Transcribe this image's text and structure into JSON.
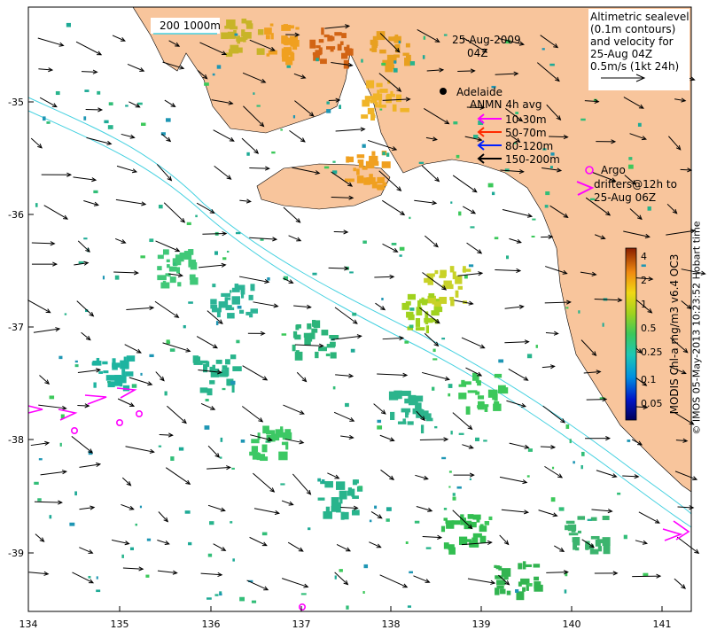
{
  "map": {
    "date": "25-Aug-2009",
    "time": "04Z",
    "city": "Adelaide",
    "scale_bar": "200  1000m",
    "legend_title": [
      "Altimetric sealevel",
      "(0.1m contours)",
      "and velocity for",
      "25-Aug 04Z",
      "0.5m/s (1kt 24h)"
    ],
    "anmn_title": "ANMN 4h avg",
    "anmn_items": [
      {
        "label": "10-30m",
        "color": "#ff00ff"
      },
      {
        "label": "50-70m",
        "color": "#ff2a00"
      },
      {
        "label": "80-120m",
        "color": "#0020ff"
      },
      {
        "label": "150-200m",
        "color": "#000000"
      }
    ],
    "argo_text": [
      "Argo",
      "drifters@12h to",
      "25-Aug 06Z"
    ],
    "colorbar_label": "MODIS Chl-a mg/m3 v6.4 OC3",
    "colorbar_ticks": [
      "4",
      "2",
      "1",
      "0.5",
      "0.25",
      "0.1",
      "0.05"
    ],
    "x_ticks": [
      "134",
      "135",
      "136",
      "137",
      "138",
      "139",
      "140",
      "141"
    ],
    "y_ticks": [
      "-35",
      "-36",
      "-37",
      "-38",
      "-39"
    ],
    "credit": "© IMOS 05-May-2013 10:23:52 Hobart time"
  },
  "colors": {
    "land": "#f8c59c",
    "contour": "#45d1e0",
    "arrow": "#000000",
    "argo": "#ff00ff"
  }
}
